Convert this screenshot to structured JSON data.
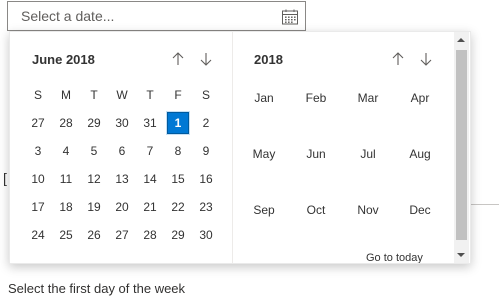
{
  "date_input": {
    "placeholder": "Select a date...",
    "icon": "calendar-icon"
  },
  "background": {
    "fragment_text": "[",
    "first_day_label": "Select the first day of the week"
  },
  "day_picker": {
    "month_title": "June 2018",
    "weekdays": [
      "S",
      "M",
      "T",
      "W",
      "T",
      "F",
      "S"
    ],
    "weeks": [
      [
        "27",
        "28",
        "29",
        "30",
        "31",
        "1",
        "2"
      ],
      [
        "3",
        "4",
        "5",
        "6",
        "7",
        "8",
        "9"
      ],
      [
        "10",
        "11",
        "12",
        "13",
        "14",
        "15",
        "16"
      ],
      [
        "17",
        "18",
        "19",
        "20",
        "21",
        "22",
        "23"
      ],
      [
        "24",
        "25",
        "26",
        "27",
        "28",
        "29",
        "30"
      ]
    ],
    "selected": "1"
  },
  "month_picker": {
    "year_title": "2018",
    "months": [
      [
        "Jan",
        "Feb",
        "Mar",
        "Apr"
      ],
      [
        "May",
        "Jun",
        "Jul",
        "Aug"
      ],
      [
        "Sep",
        "Oct",
        "Nov",
        "Dec"
      ]
    ],
    "go_to_today": "Go to today"
  },
  "colors": {
    "accent": "#0078d4",
    "text": "#333333",
    "border": "#8a8886"
  }
}
